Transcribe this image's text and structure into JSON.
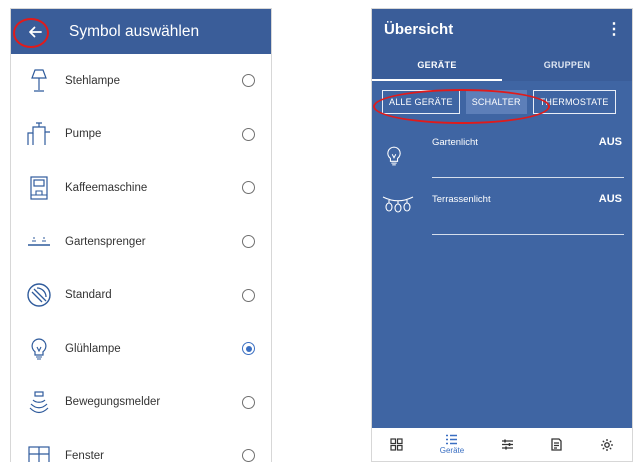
{
  "left_screen": {
    "title": "Symbol auswählen",
    "back_icon": "arrow-left-icon",
    "items": [
      {
        "label": "Stehlampe",
        "icon": "floor-lamp-icon",
        "selected": false
      },
      {
        "label": "Pumpe",
        "icon": "pump-icon",
        "selected": false
      },
      {
        "label": "Kaffeemaschine",
        "icon": "coffee-machine-icon",
        "selected": false
      },
      {
        "label": "Gartensprenger",
        "icon": "sprinkler-icon",
        "selected": false
      },
      {
        "label": "Standard",
        "icon": "plug-icon",
        "selected": false
      },
      {
        "label": "Glühlampe",
        "icon": "light-bulb-icon",
        "selected": true
      },
      {
        "label": "Bewegungsmelder",
        "icon": "motion-sensor-icon",
        "selected": false
      },
      {
        "label": "Fenster",
        "icon": "window-icon",
        "selected": false
      }
    ]
  },
  "right_screen": {
    "title": "Übersicht",
    "menu_icon": "more-vert-icon",
    "tabs": [
      {
        "label": "GERÄTE",
        "active": true
      },
      {
        "label": "GRUPPEN",
        "active": false
      }
    ],
    "filters": [
      {
        "label": "ALLE GERÄTE",
        "style": "outlined"
      },
      {
        "label": "SCHALTER",
        "style": "filled"
      },
      {
        "label": "THERMOSTATE",
        "style": "outlined"
      }
    ],
    "devices": [
      {
        "name": "Gartenlicht",
        "status": "AUS",
        "icon": "light-bulb-icon"
      },
      {
        "name": "Terrassenlicht",
        "status": "AUS",
        "icon": "string-lights-icon"
      }
    ],
    "bottom_nav": [
      {
        "label": "",
        "icon": "dashboard-icon",
        "active": false
      },
      {
        "label": "Geräte",
        "icon": "list-icon",
        "active": true
      },
      {
        "label": "",
        "icon": "tune-icon",
        "active": false
      },
      {
        "label": "",
        "icon": "log-icon",
        "active": false
      },
      {
        "label": "",
        "icon": "settings-gear-icon",
        "active": false
      }
    ]
  },
  "annotations": {
    "highlight_color": "#e01b1b"
  },
  "colors": {
    "app_bar": "#3a5d99",
    "content_bg": "#3f65a3",
    "accent": "#3a6fc2"
  }
}
